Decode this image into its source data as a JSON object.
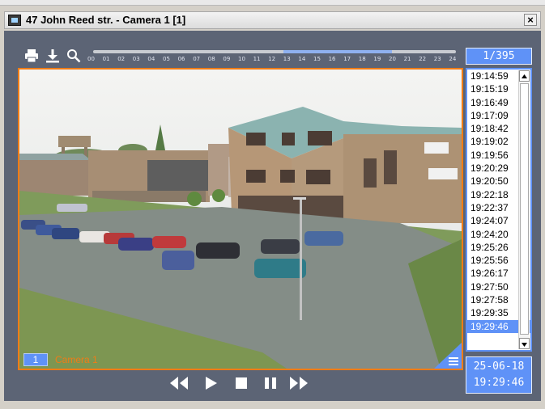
{
  "window": {
    "title": "47 John Reed str. - Camera 1 [1]",
    "close_glyph": "×"
  },
  "toolbar": {
    "icons": [
      "print-icon",
      "download-icon",
      "search-icon"
    ]
  },
  "timeline": {
    "hours": [
      "00",
      "01",
      "02",
      "03",
      "04",
      "05",
      "06",
      "07",
      "08",
      "09",
      "10",
      "11",
      "12",
      "13",
      "14",
      "15",
      "16",
      "17",
      "18",
      "19",
      "20",
      "21",
      "22",
      "23",
      "24"
    ]
  },
  "counter": {
    "text": "1/395"
  },
  "camera": {
    "number": "1",
    "name": "Camera 1"
  },
  "times": [
    "19:14:59",
    "19:15:19",
    "19:16:49",
    "19:17:09",
    "19:18:42",
    "19:19:02",
    "19:19:56",
    "19:20:29",
    "19:20:50",
    "19:22:18",
    "19:22:37",
    "19:24:07",
    "19:24:20",
    "19:25:26",
    "19:25:56",
    "19:26:17",
    "19:27:50",
    "19:27:58",
    "19:29:35",
    "19:29:46"
  ],
  "selected_time_index": 19,
  "datetime": {
    "date": "25-06-18",
    "time": "19:29:46"
  },
  "playback": {
    "controls": [
      "rewind-icon",
      "play-icon",
      "stop-icon",
      "pause-icon",
      "fast-forward-icon"
    ]
  },
  "colors": {
    "accent": "#5f92f7",
    "frame": "#f07c16",
    "panel": "#5c6475"
  }
}
